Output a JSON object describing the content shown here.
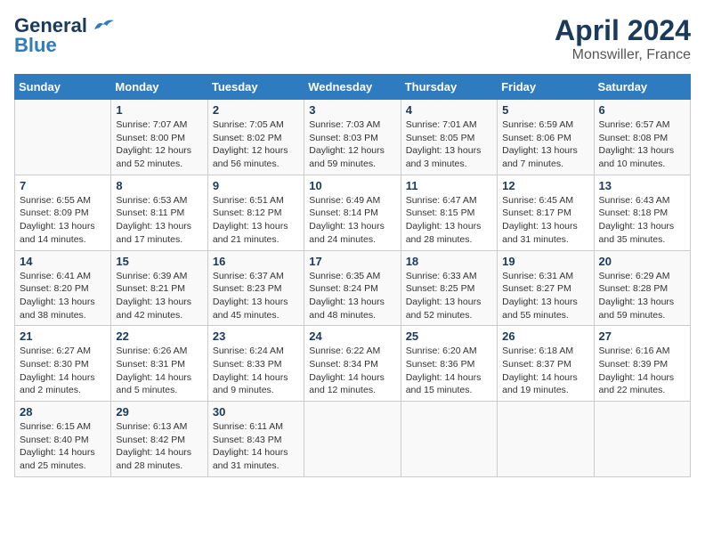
{
  "header": {
    "logo_general": "General",
    "logo_blue": "Blue",
    "title": "April 2024",
    "subtitle": "Monswiller, France"
  },
  "calendar": {
    "days_of_week": [
      "Sunday",
      "Monday",
      "Tuesday",
      "Wednesday",
      "Thursday",
      "Friday",
      "Saturday"
    ],
    "weeks": [
      [
        {
          "day": "",
          "info": ""
        },
        {
          "day": "1",
          "info": "Sunrise: 7:07 AM\nSunset: 8:00 PM\nDaylight: 12 hours\nand 52 minutes."
        },
        {
          "day": "2",
          "info": "Sunrise: 7:05 AM\nSunset: 8:02 PM\nDaylight: 12 hours\nand 56 minutes."
        },
        {
          "day": "3",
          "info": "Sunrise: 7:03 AM\nSunset: 8:03 PM\nDaylight: 12 hours\nand 59 minutes."
        },
        {
          "day": "4",
          "info": "Sunrise: 7:01 AM\nSunset: 8:05 PM\nDaylight: 13 hours\nand 3 minutes."
        },
        {
          "day": "5",
          "info": "Sunrise: 6:59 AM\nSunset: 8:06 PM\nDaylight: 13 hours\nand 7 minutes."
        },
        {
          "day": "6",
          "info": "Sunrise: 6:57 AM\nSunset: 8:08 PM\nDaylight: 13 hours\nand 10 minutes."
        }
      ],
      [
        {
          "day": "7",
          "info": "Sunrise: 6:55 AM\nSunset: 8:09 PM\nDaylight: 13 hours\nand 14 minutes."
        },
        {
          "day": "8",
          "info": "Sunrise: 6:53 AM\nSunset: 8:11 PM\nDaylight: 13 hours\nand 17 minutes."
        },
        {
          "day": "9",
          "info": "Sunrise: 6:51 AM\nSunset: 8:12 PM\nDaylight: 13 hours\nand 21 minutes."
        },
        {
          "day": "10",
          "info": "Sunrise: 6:49 AM\nSunset: 8:14 PM\nDaylight: 13 hours\nand 24 minutes."
        },
        {
          "day": "11",
          "info": "Sunrise: 6:47 AM\nSunset: 8:15 PM\nDaylight: 13 hours\nand 28 minutes."
        },
        {
          "day": "12",
          "info": "Sunrise: 6:45 AM\nSunset: 8:17 PM\nDaylight: 13 hours\nand 31 minutes."
        },
        {
          "day": "13",
          "info": "Sunrise: 6:43 AM\nSunset: 8:18 PM\nDaylight: 13 hours\nand 35 minutes."
        }
      ],
      [
        {
          "day": "14",
          "info": "Sunrise: 6:41 AM\nSunset: 8:20 PM\nDaylight: 13 hours\nand 38 minutes."
        },
        {
          "day": "15",
          "info": "Sunrise: 6:39 AM\nSunset: 8:21 PM\nDaylight: 13 hours\nand 42 minutes."
        },
        {
          "day": "16",
          "info": "Sunrise: 6:37 AM\nSunset: 8:23 PM\nDaylight: 13 hours\nand 45 minutes."
        },
        {
          "day": "17",
          "info": "Sunrise: 6:35 AM\nSunset: 8:24 PM\nDaylight: 13 hours\nand 48 minutes."
        },
        {
          "day": "18",
          "info": "Sunrise: 6:33 AM\nSunset: 8:25 PM\nDaylight: 13 hours\nand 52 minutes."
        },
        {
          "day": "19",
          "info": "Sunrise: 6:31 AM\nSunset: 8:27 PM\nDaylight: 13 hours\nand 55 minutes."
        },
        {
          "day": "20",
          "info": "Sunrise: 6:29 AM\nSunset: 8:28 PM\nDaylight: 13 hours\nand 59 minutes."
        }
      ],
      [
        {
          "day": "21",
          "info": "Sunrise: 6:27 AM\nSunset: 8:30 PM\nDaylight: 14 hours\nand 2 minutes."
        },
        {
          "day": "22",
          "info": "Sunrise: 6:26 AM\nSunset: 8:31 PM\nDaylight: 14 hours\nand 5 minutes."
        },
        {
          "day": "23",
          "info": "Sunrise: 6:24 AM\nSunset: 8:33 PM\nDaylight: 14 hours\nand 9 minutes."
        },
        {
          "day": "24",
          "info": "Sunrise: 6:22 AM\nSunset: 8:34 PM\nDaylight: 14 hours\nand 12 minutes."
        },
        {
          "day": "25",
          "info": "Sunrise: 6:20 AM\nSunset: 8:36 PM\nDaylight: 14 hours\nand 15 minutes."
        },
        {
          "day": "26",
          "info": "Sunrise: 6:18 AM\nSunset: 8:37 PM\nDaylight: 14 hours\nand 19 minutes."
        },
        {
          "day": "27",
          "info": "Sunrise: 6:16 AM\nSunset: 8:39 PM\nDaylight: 14 hours\nand 22 minutes."
        }
      ],
      [
        {
          "day": "28",
          "info": "Sunrise: 6:15 AM\nSunset: 8:40 PM\nDaylight: 14 hours\nand 25 minutes."
        },
        {
          "day": "29",
          "info": "Sunrise: 6:13 AM\nSunset: 8:42 PM\nDaylight: 14 hours\nand 28 minutes."
        },
        {
          "day": "30",
          "info": "Sunrise: 6:11 AM\nSunset: 8:43 PM\nDaylight: 14 hours\nand 31 minutes."
        },
        {
          "day": "",
          "info": ""
        },
        {
          "day": "",
          "info": ""
        },
        {
          "day": "",
          "info": ""
        },
        {
          "day": "",
          "info": ""
        }
      ]
    ]
  }
}
